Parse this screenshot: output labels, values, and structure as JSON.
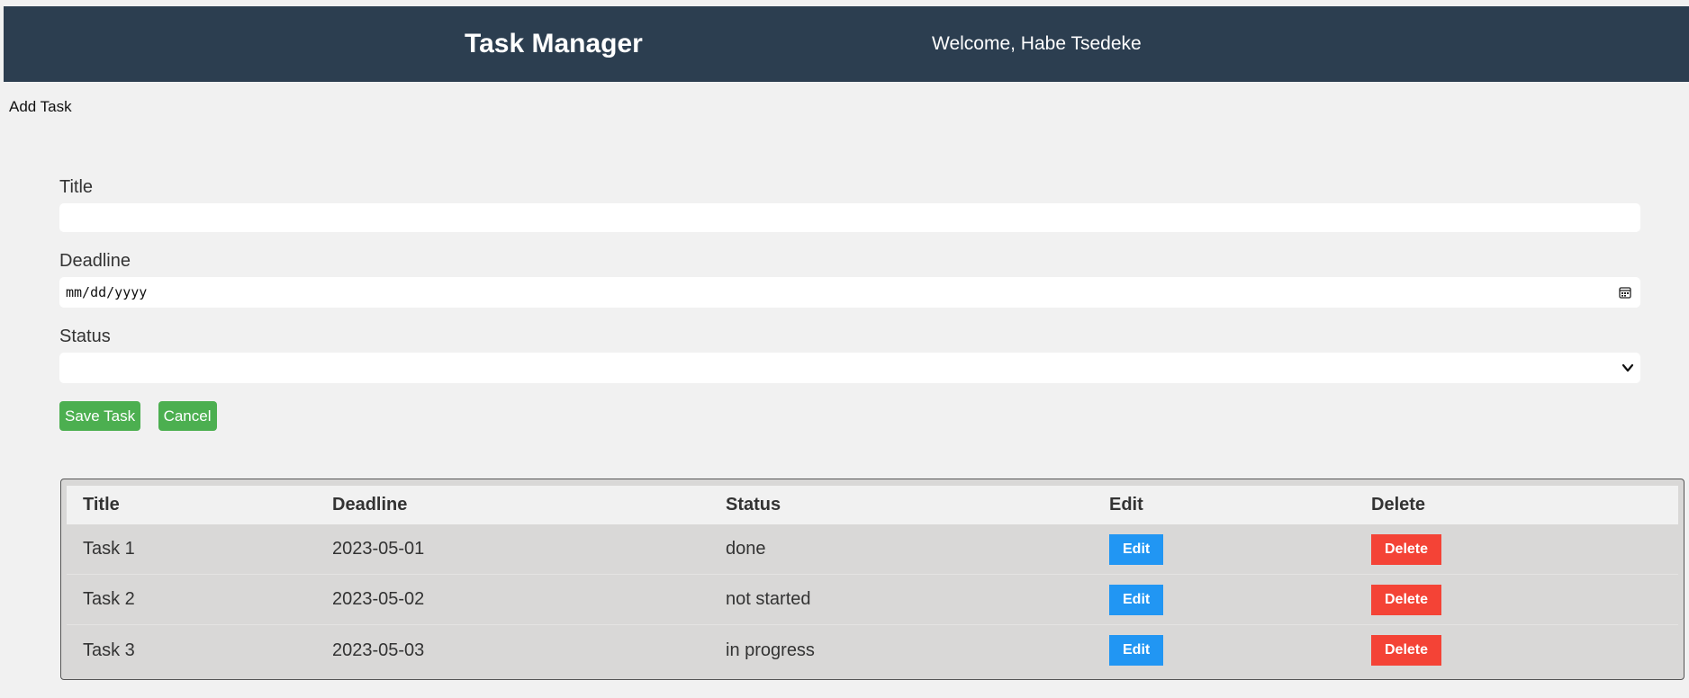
{
  "header": {
    "title": "Task Manager",
    "welcome": "Welcome, Habe Tsedeke"
  },
  "nav": {
    "add_task_link": "Add Task"
  },
  "form": {
    "title_label": "Title",
    "title_value": "",
    "deadline_label": "Deadline",
    "deadline_placeholder": "mm/dd/yyyy",
    "status_label": "Status",
    "status_value": "",
    "save_label": "Save Task",
    "cancel_label": "Cancel"
  },
  "table": {
    "headers": [
      "Title",
      "Deadline",
      "Status",
      "Edit",
      "Delete"
    ],
    "rows": [
      {
        "title": "Task 1",
        "deadline": "2023-05-01",
        "status": "done",
        "edit": "Edit",
        "delete": "Delete"
      },
      {
        "title": "Task 2",
        "deadline": "2023-05-02",
        "status": "not started",
        "edit": "Edit",
        "delete": "Delete"
      },
      {
        "title": "Task 3",
        "deadline": "2023-05-03",
        "status": "in progress",
        "edit": "Edit",
        "delete": "Delete"
      }
    ]
  },
  "colors": {
    "header_bg": "#2c3e50",
    "save_button": "#4caf50",
    "edit_button": "#2196f3",
    "delete_button": "#f44336",
    "page_bg": "#f1f1f1"
  },
  "icons": {
    "deadline": "calendar-icon",
    "status": "chevron-down-icon"
  }
}
